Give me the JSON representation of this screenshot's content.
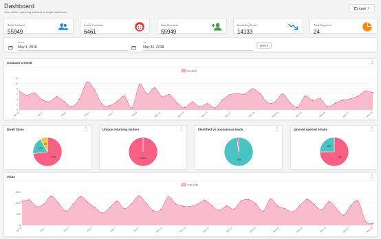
{
  "header": {
    "title": "Dashboard",
    "subtitle": "View all the marketing activities at single dashboard",
    "save_label": "SAVE"
  },
  "kpis": [
    {
      "label": "Total Contacts",
      "value": "55949",
      "icon": "users-icon",
      "color": "#1e88e5"
    },
    {
      "label": "Active Contacts",
      "value": "6461",
      "icon": "smiley-icon",
      "color": "#e53935"
    },
    {
      "label": "New Contacts",
      "value": "55949",
      "icon": "person-add-icon",
      "color": "#43a047"
    },
    {
      "label": "Marketing Churn",
      "value": "14133",
      "icon": "trending-down-icon",
      "color": "#1e88e5"
    },
    {
      "label": "Total Segment",
      "value": "24",
      "icon": "pie-chart-icon",
      "color": "#fb8c00"
    }
  ],
  "date_filter": {
    "from_label": "From",
    "from_value": "May 1, 2018",
    "to_label": "To",
    "to_value": "May 31, 2018",
    "apply_label": "APPLY"
  },
  "contacts_card": {
    "title": "Contacts created"
  },
  "small_cards": [
    {
      "title": "Dwell times"
    },
    {
      "title": "Unique returning visitors"
    },
    {
      "title": "Identified vs anonymous leads"
    },
    {
      "title": "Ignored opened emails"
    }
  ],
  "visits_card": {
    "title": "Visits"
  },
  "colors": {
    "area_fill": "#f8b5c6",
    "area_stroke": "#ef6d90",
    "pie_pink": "#f75f83",
    "pie_teal": "#4cc3c3",
    "pie_yellow": "#f5c342",
    "accent": "#1e88e5"
  },
  "chart_data": [
    {
      "type": "area",
      "legend": [
        "Identified"
      ],
      "legend_position": "top-center",
      "x": [
        "Apr 29",
        "May 1",
        "May 3",
        "May 5",
        "May 7",
        "May 9",
        "May 11",
        "May 13",
        "May 15",
        "May 17",
        "May 19",
        "May 21",
        "May 23",
        "May 25",
        "May 27",
        "May 29"
      ],
      "y_ticks": [
        "0",
        "2",
        "4",
        "6",
        "8",
        "10",
        "12"
      ],
      "ylim": [
        0,
        12
      ],
      "series": [
        {
          "name": "Identified",
          "values": [
            7.2,
            5.6,
            6.4,
            4.0,
            3.1,
            5.0,
            3.1,
            1.2,
            4.1,
            10.6,
            7.6,
            2.2,
            1.6,
            3.2,
            5.2,
            0.8,
            9.7,
            6.0,
            8.4,
            5.0,
            5.8,
            2.6,
            0.9,
            3.0,
            1.1,
            2.4,
            0.8,
            3.8,
            5.8,
            6.2,
            6.0,
            8.0,
            6.2,
            2.8,
            3.0,
            6.1,
            2.8,
            1.0,
            5.2,
            3.6,
            4.3,
            1.1,
            2.6,
            3.7,
            4.2,
            5.2,
            7.2,
            6.6
          ]
        }
      ]
    },
    {
      "type": "pie",
      "title": "Dwell times",
      "slices": [
        {
          "label": "73%",
          "value": 73,
          "color": "#f75f83"
        },
        {
          "label": "19%",
          "value": 19,
          "color": "#4cc3c3"
        },
        {
          "label": "8%",
          "value": 8,
          "color": "#f5c342"
        }
      ]
    },
    {
      "type": "pie",
      "title": "Unique returning visitors",
      "slices": [
        {
          "label": "100%",
          "value": 100,
          "color": "#f75f83"
        }
      ]
    },
    {
      "type": "pie",
      "title": "Identified vs anonymous leads",
      "slices": [
        {
          "label": "98%",
          "value": 98,
          "color": "#4cc3c3"
        },
        {
          "label": "",
          "value": 2,
          "color": "#f75f83"
        }
      ]
    },
    {
      "type": "pie",
      "title": "Ignored opened emails",
      "slices": [
        {
          "label": "75%",
          "value": 75,
          "color": "#f75f83"
        },
        {
          "label": "25%",
          "value": 25,
          "color": "#4cc3c3"
        }
      ]
    },
    {
      "type": "area",
      "legend": [
        "Total visits"
      ],
      "legend_position": "top-center",
      "x": [
        "Apr 29",
        "May 1",
        "May 3",
        "May 5",
        "May 7",
        "May 9",
        "May 11",
        "May 13",
        "May 15",
        "May 17",
        "May 19",
        "May 21",
        "May 23",
        "May 25",
        "May 27",
        "May 29"
      ],
      "y_ticks": [
        "0",
        "500",
        "1000",
        "1500"
      ],
      "ylim": [
        0,
        1500
      ],
      "series": [
        {
          "name": "Total visits",
          "values": [
            1080,
            1150,
            850,
            960,
            1330,
            1000,
            640,
            960,
            1310,
            1050,
            800,
            560,
            800,
            1100,
            760,
            980,
            1340,
            1000,
            660,
            720,
            1300,
            980,
            870,
            860,
            960,
            1140,
            900,
            680,
            880,
            740,
            1110,
            1170,
            980,
            640,
            1200,
            880,
            760,
            610,
            890,
            1180,
            940,
            700,
            1080,
            780,
            460,
            890,
            1100,
            200,
            90
          ]
        }
      ]
    }
  ]
}
